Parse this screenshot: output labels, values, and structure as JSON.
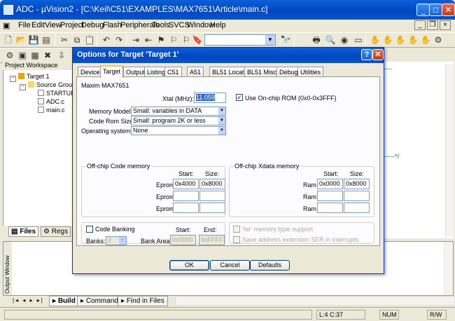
{
  "window": {
    "title": "ADC - µVision2 - [C:\\Keil\\C51\\EXAMPLES\\MAX7651\\Article\\main.c]"
  },
  "menu": [
    "File",
    "Edit",
    "View",
    "Project",
    "Debug",
    "Flash",
    "Peripherals",
    "Tools",
    "SVCS",
    "Window",
    "Help"
  ],
  "workspace": {
    "title": "Project Workspace",
    "tree": [
      "Target 1",
      "Source Group 1",
      "STARTUP.A51",
      "ADC.c",
      "main.c"
    ],
    "tabs": [
      "Files",
      "Regs"
    ]
  },
  "output": {
    "side_label": "Output Window",
    "tabs": [
      "Build",
      "Command",
      "Find in Files"
    ]
  },
  "status": {
    "position": "L:4 C:37",
    "num": "NUM",
    "rw": "R/W"
  },
  "dialog": {
    "title": "Options for Target 'Target 1'",
    "tabs": [
      "Device",
      "Target",
      "Output",
      "Listing",
      "C51",
      "A51",
      "BL51 Locate",
      "BL51 Misc",
      "Debug",
      "Utilities"
    ],
    "active_tab": "Target",
    "device_name": "Maxim MAX7651",
    "xtal_label": "Xtal (MHz):",
    "xtal_value": "11.059",
    "onchip_rom_label": "Use On-chip ROM (0x0-0x3FFF)",
    "onchip_rom_checked": true,
    "memory_model_label": "Memory Model:",
    "memory_model_value": "Small: variables in DATA",
    "code_rom_label": "Code Rom Size:",
    "code_rom_value": "Small: program 2K or less",
    "os_label": "Operating system:",
    "os_value": "None",
    "code_memory": {
      "title": "Off-chip Code memory",
      "start_header": "Start:",
      "size_header": "Size:",
      "rows": [
        {
          "label": "Eprom",
          "start": "0x4000",
          "size": "0x8000"
        },
        {
          "label": "Eprom",
          "start": "",
          "size": ""
        },
        {
          "label": "Eprom",
          "start": "",
          "size": ""
        }
      ]
    },
    "xdata_memory": {
      "title": "Off-chip Xdata memory",
      "start_header": "Start:",
      "size_header": "Size:",
      "rows": [
        {
          "label": "Ram",
          "start": "0x0000",
          "size": "0x8000"
        },
        {
          "label": "Ram",
          "start": "",
          "size": ""
        },
        {
          "label": "Ram",
          "start": "",
          "size": ""
        }
      ]
    },
    "banking": {
      "code_banking_label": "Code Banking",
      "start_header": "Start:",
      "end_header": "End:",
      "banks_label": "Banks:",
      "banks_value": "2",
      "bank_area_label": "Bank Area:",
      "bank_start": "0x0000",
      "bank_end": "0xFFFF",
      "far_label": "'far' memory type support",
      "sfr_label": "Save address extension SFR in interrupts"
    },
    "buttons": {
      "ok": "OK",
      "cancel": "Cancel",
      "defaults": "Defaults"
    }
  },
  "colors": {
    "titlebar": "#0054e3",
    "face": "#ece9d8",
    "tab_highlight": "#ffc83c",
    "close": "#c0391b"
  }
}
